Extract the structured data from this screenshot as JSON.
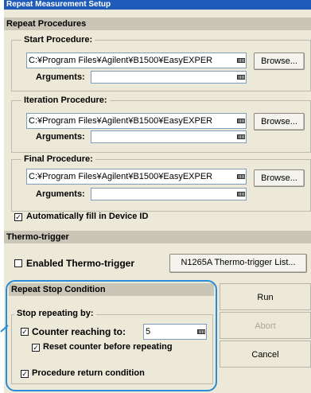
{
  "window": {
    "title": "Repeat Measurement Setup"
  },
  "repeat_procedures": {
    "title": "Repeat Procedures",
    "start": {
      "legend": "Start Procedure:",
      "path": "C:¥Program Files¥Agilent¥B1500¥EasyEXPER",
      "browse": "Browse...",
      "args_label": "Arguments:",
      "args_value": ""
    },
    "iteration": {
      "legend": "Iteration Procedure:",
      "path": "C:¥Program Files¥Agilent¥B1500¥EasyEXPER",
      "browse": "Browse...",
      "args_label": "Arguments:",
      "args_value": ""
    },
    "final": {
      "legend": "Final Procedure:",
      "path": "C:¥Program Files¥Agilent¥B1500¥EasyEXPER",
      "browse": "Browse...",
      "args_label": "Arguments:",
      "args_value": ""
    },
    "autofill": {
      "checked": true,
      "label": "Automatically fill in Device ID"
    }
  },
  "thermo": {
    "title": "Thermo-trigger",
    "enabled": {
      "checked": false,
      "label": "Enabled Thermo-trigger"
    },
    "list_button": "N1265A Thermo-trigger List..."
  },
  "stop": {
    "title": "Repeat Stop Condition",
    "legend": "Stop repeating by:",
    "counter": {
      "checked": true,
      "label": "Counter reaching to:",
      "value": "5"
    },
    "reset": {
      "checked": true,
      "label": "Reset counter before repeating"
    },
    "procedure_return": {
      "checked": true,
      "label": "Procedure return condition"
    }
  },
  "actions": {
    "run": "Run",
    "abort": "Abort",
    "cancel": "Cancel"
  },
  "colors": {
    "titlebar": "#1f5bb8",
    "highlight": "#2a8bd8",
    "face": "#ece9d8"
  }
}
